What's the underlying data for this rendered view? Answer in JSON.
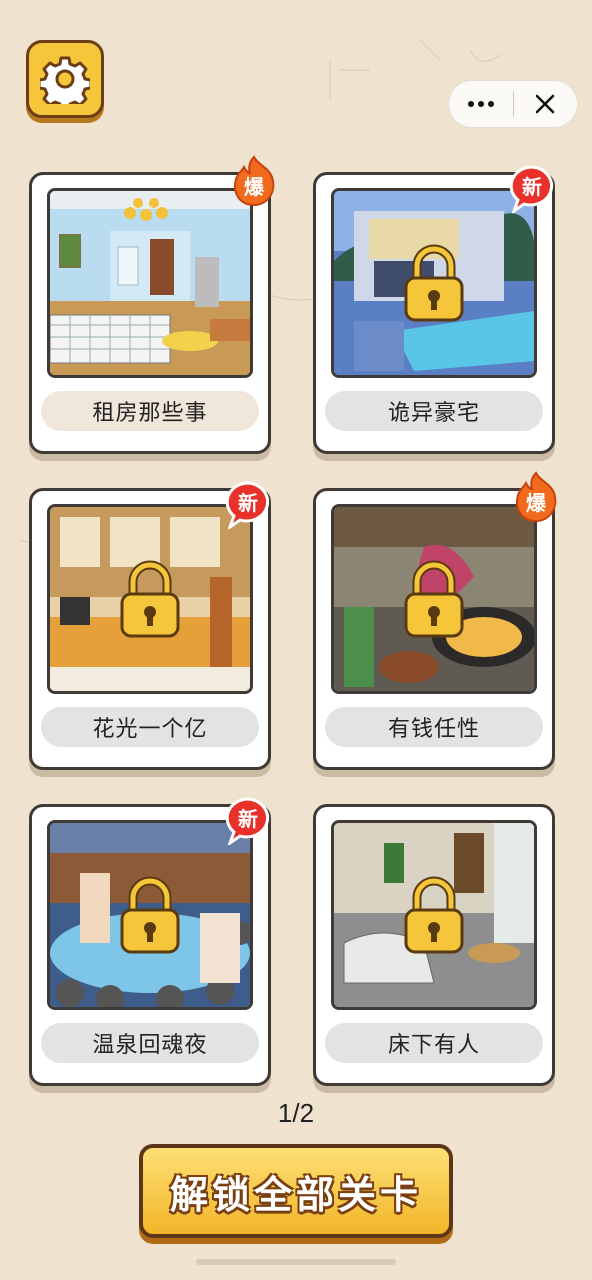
{
  "header": {
    "settings_icon": "gear-icon",
    "capsule": {
      "more_icon": "more-dots-icon",
      "close_icon": "close-icon"
    }
  },
  "levels": [
    {
      "title": "租房那些事",
      "badge": "爆",
      "badge_type": "hot",
      "locked": false,
      "scene": "rented-bedroom"
    },
    {
      "title": "诡异豪宅",
      "badge": "新",
      "badge_type": "new",
      "locked": true,
      "scene": "modern-villa-pool"
    },
    {
      "title": "花光一个亿",
      "badge": "新",
      "badge_type": "new",
      "locked": true,
      "scene": "luxury-shop"
    },
    {
      "title": "有钱任性",
      "badge": "爆",
      "badge_type": "hot",
      "locked": true,
      "scene": "kitchen-cooking"
    },
    {
      "title": "温泉回魂夜",
      "badge": "新",
      "badge_type": "new",
      "locked": true,
      "scene": "hot-spring"
    },
    {
      "title": "床下有人",
      "badge": "",
      "badge_type": "",
      "locked": true,
      "scene": "bedroom-intruder"
    }
  ],
  "pagination": {
    "text": "1/2"
  },
  "unlock_all_button": {
    "label": "解锁全部关卡"
  },
  "colors": {
    "accent_yellow": "#f6c63a",
    "badge_red": "#e8312a",
    "badge_orange": "#f26a1b",
    "background": "#efe3cf"
  }
}
